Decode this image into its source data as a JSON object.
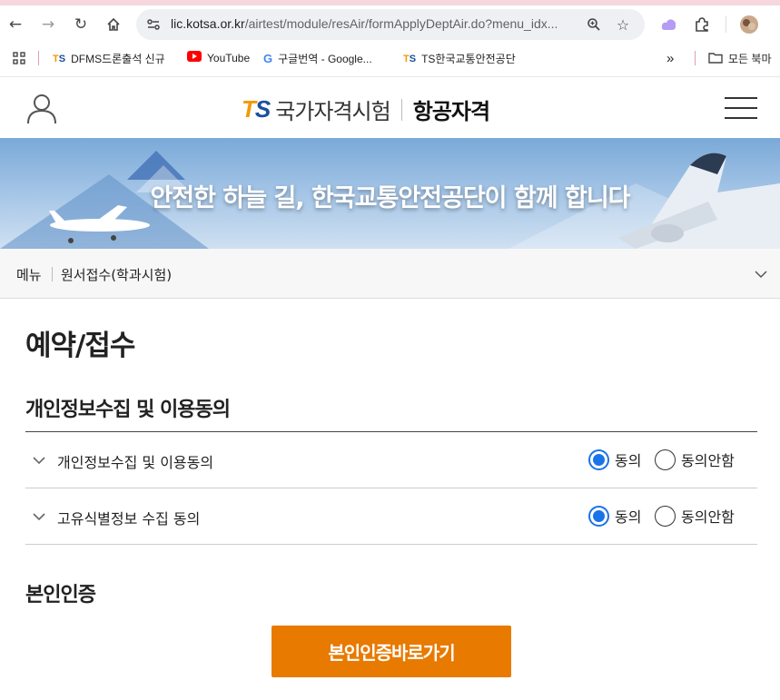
{
  "browser": {
    "url_host": "lic.kotsa.or.kr",
    "url_path": "/airtest/module/resAir/formApplyDeptAir.do?menu_idx...",
    "bookmarks": [
      {
        "icon": "TS",
        "label": "DFMS드론출석 신규"
      },
      {
        "icon": "youtube-icon",
        "label": "YouTube"
      },
      {
        "icon": "G",
        "label": "구글번역 - Google..."
      },
      {
        "icon": "TS",
        "label": "TS한국교통안전공단"
      }
    ],
    "bookmarks_overflow": "»",
    "all_bookmarks_label": "모든 북마"
  },
  "header": {
    "logo_mark": "TS",
    "logo_name": "국가자격시험",
    "logo_sub": "항공자격"
  },
  "banner": {
    "slogan": "안전한 하늘 길, 한국교통안전공단이 함께 합니다"
  },
  "breadcrumb": {
    "menu": "메뉴",
    "current": "원서접수(학과시험)"
  },
  "main": {
    "page_title": "예약/접수",
    "consent_section_title": "개인정보수집 및 이용동의",
    "consent_rows": [
      {
        "label": "개인정보수집 및 이용동의",
        "agree": "동의",
        "disagree": "동의안함",
        "selected": "agree"
      },
      {
        "label": "고유식별정보 수집 동의",
        "agree": "동의",
        "disagree": "동의안함",
        "selected": "agree"
      }
    ],
    "auth_section_title": "본인인증",
    "auth_button": "본인인증바로가기"
  },
  "colors": {
    "accent_orange": "#e87a00",
    "radio_blue": "#1a73e8",
    "logo_orange": "#f29a00",
    "logo_blue": "#1a4fa0"
  }
}
